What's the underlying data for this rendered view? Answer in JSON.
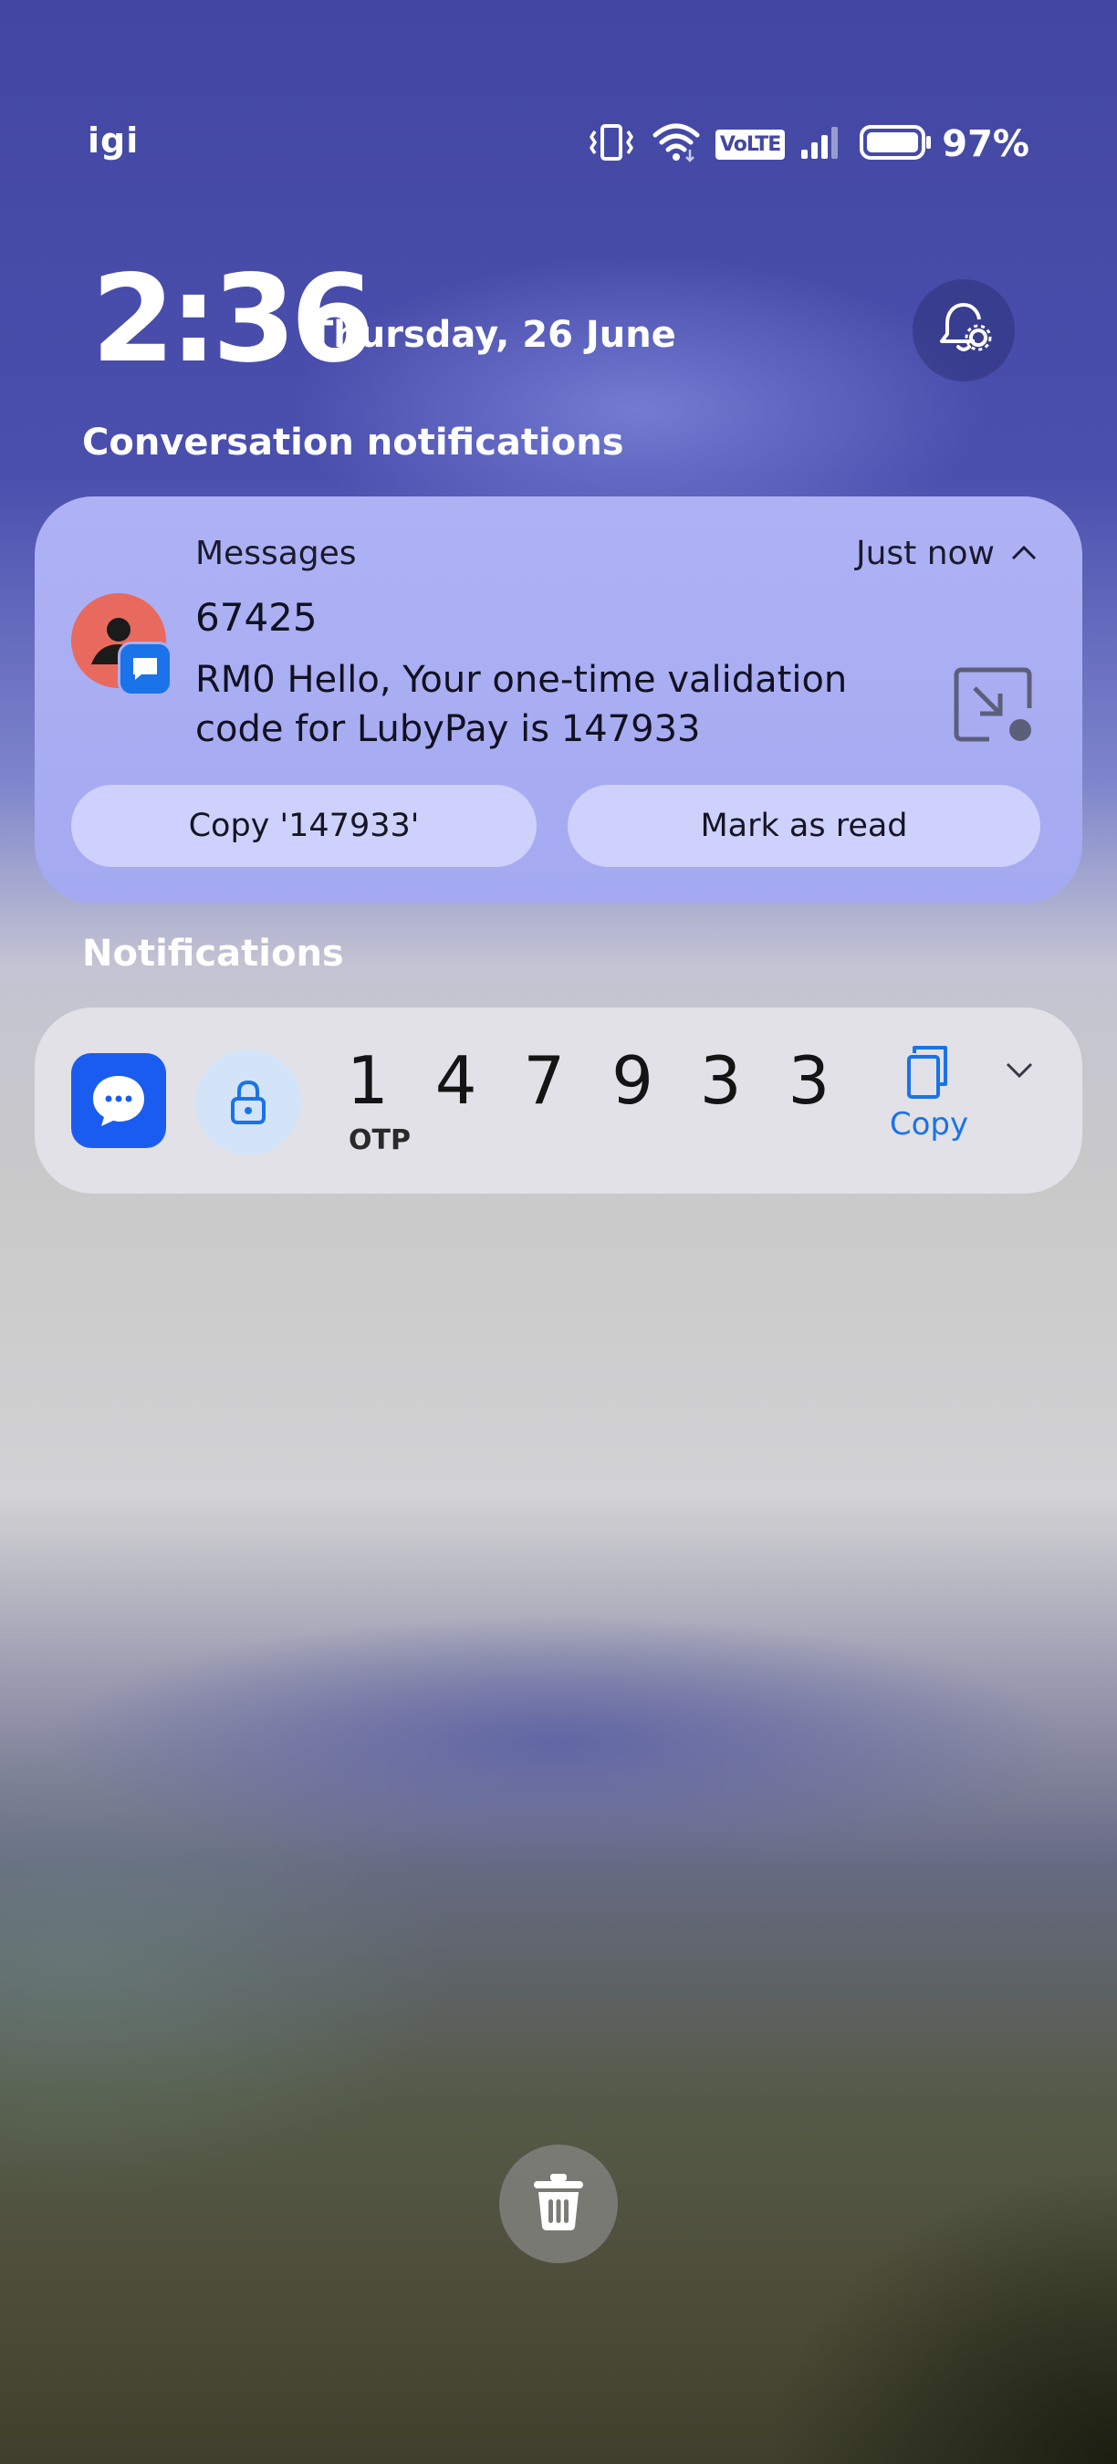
{
  "status_bar": {
    "carrier": "igi",
    "volte": "VoLTE",
    "battery": "97%",
    "icons": [
      "vibrate-icon",
      "wifi-icon",
      "volte-icon",
      "signal-icon",
      "battery-icon"
    ]
  },
  "lockscreen": {
    "time": "2:36",
    "date": "Thursday, 26 June",
    "settings_icon": "bell-gear-icon"
  },
  "sections": {
    "conversation": "Conversation notifications",
    "notifications": "Notifications"
  },
  "conversation_card": {
    "app": "Messages",
    "timestamp": "Just now",
    "sender": "67425",
    "message": "RM0 Hello, Your one-time validation code for LubyPay is 147933",
    "actions": {
      "copy": "Copy '147933'",
      "mark_read": "Mark as read"
    },
    "colors": {
      "avatar": "#e86a5e",
      "badge": "#1a73e8"
    }
  },
  "otp_card": {
    "code": "1 4 7 9 3 3",
    "label": "OTP",
    "copy_label": "Copy",
    "accent": "#1a73e8"
  },
  "bottom": {
    "trash_icon": "trash-icon"
  }
}
